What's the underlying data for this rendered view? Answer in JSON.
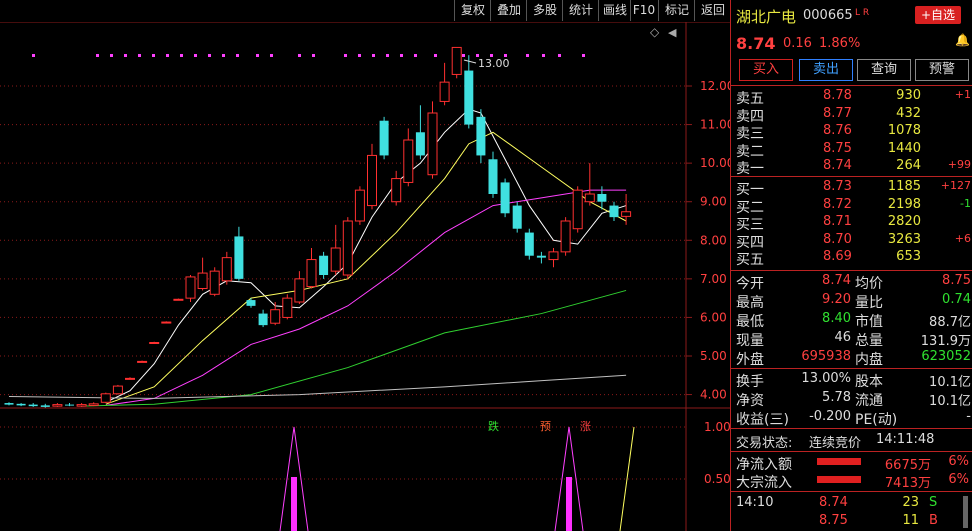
{
  "toolbar": {
    "buttons": [
      "复权",
      "叠加",
      "多股",
      "统计",
      "画线",
      "F10",
      "标记",
      "返回"
    ]
  },
  "chart": {
    "max_label": "13.00",
    "y_ticks": [
      "12.00",
      "11.00",
      "10.00",
      "9.00",
      "8.00",
      "7.00",
      "6.00",
      "5.00",
      "4.00"
    ],
    "sub_ticks": [
      "1.00",
      "0.50"
    ],
    "markers": [
      {
        "text": "跌",
        "color": "#30e030"
      },
      {
        "text": "预",
        "color": "#ff6030"
      },
      {
        "text": "涨",
        "color": "#ff4040"
      }
    ],
    "colors": {
      "up": "#ff3030",
      "down": "#40e0e0",
      "ma5": "#ffffff",
      "ma10": "#ffff60",
      "ma20": "#ff40ff",
      "ma60": "#30d030",
      "ma120": "#c0c0c0",
      "grid": "#8b1a1a"
    }
  },
  "chart_data": {
    "type": "candlestick",
    "ylim": [
      3.6,
      13.4
    ],
    "candles": [
      {
        "o": 3.78,
        "c": 3.74,
        "h": 3.8,
        "l": 3.72
      },
      {
        "o": 3.76,
        "c": 3.72,
        "h": 3.78,
        "l": 3.7
      },
      {
        "o": 3.74,
        "c": 3.7,
        "h": 3.78,
        "l": 3.68
      },
      {
        "o": 3.72,
        "c": 3.68,
        "h": 3.76,
        "l": 3.66
      },
      {
        "o": 3.7,
        "c": 3.74,
        "h": 3.78,
        "l": 3.68
      },
      {
        "o": 3.74,
        "c": 3.72,
        "h": 3.78,
        "l": 3.7
      },
      {
        "o": 3.7,
        "c": 3.74,
        "h": 3.78,
        "l": 3.68
      },
      {
        "o": 3.72,
        "c": 3.76,
        "h": 3.8,
        "l": 3.7
      },
      {
        "o": 3.8,
        "c": 4.02,
        "h": 4.05,
        "l": 3.78
      },
      {
        "o": 4.02,
        "c": 4.22,
        "h": 4.25,
        "l": 4.0
      },
      {
        "o": 4.42,
        "c": 4.42,
        "h": 4.45,
        "l": 4.4
      },
      {
        "o": 4.86,
        "c": 4.86,
        "h": 4.88,
        "l": 4.84
      },
      {
        "o": 5.35,
        "c": 5.35,
        "h": 5.37,
        "l": 5.33
      },
      {
        "o": 5.88,
        "c": 5.88,
        "h": 5.9,
        "l": 5.86
      },
      {
        "o": 6.47,
        "c": 6.47,
        "h": 6.49,
        "l": 6.45
      },
      {
        "o": 6.5,
        "c": 7.05,
        "h": 7.1,
        "l": 6.4
      },
      {
        "o": 6.75,
        "c": 7.15,
        "h": 7.55,
        "l": 6.7
      },
      {
        "o": 6.6,
        "c": 7.2,
        "h": 7.3,
        "l": 6.55
      },
      {
        "o": 6.95,
        "c": 7.55,
        "h": 7.7,
        "l": 6.85
      },
      {
        "o": 8.1,
        "c": 7.0,
        "h": 8.35,
        "l": 6.95
      },
      {
        "o": 6.45,
        "c": 6.3,
        "h": 6.5,
        "l": 6.25
      },
      {
        "o": 6.1,
        "c": 5.8,
        "h": 6.2,
        "l": 5.75
      },
      {
        "o": 5.85,
        "c": 6.2,
        "h": 6.4,
        "l": 5.8
      },
      {
        "o": 6.0,
        "c": 6.5,
        "h": 6.6,
        "l": 5.95
      },
      {
        "o": 6.4,
        "c": 7.0,
        "h": 7.2,
        "l": 6.35
      },
      {
        "o": 6.8,
        "c": 7.5,
        "h": 7.8,
        "l": 6.75
      },
      {
        "o": 7.6,
        "c": 7.1,
        "h": 7.7,
        "l": 7.0
      },
      {
        "o": 7.2,
        "c": 7.8,
        "h": 8.4,
        "l": 7.1
      },
      {
        "o": 7.1,
        "c": 8.5,
        "h": 8.6,
        "l": 7.0
      },
      {
        "o": 8.5,
        "c": 9.3,
        "h": 9.4,
        "l": 8.4
      },
      {
        "o": 8.9,
        "c": 10.2,
        "h": 10.5,
        "l": 8.8
      },
      {
        "o": 11.1,
        "c": 10.2,
        "h": 11.2,
        "l": 10.1
      },
      {
        "o": 9.0,
        "c": 9.6,
        "h": 9.8,
        "l": 8.9
      },
      {
        "o": 9.5,
        "c": 10.6,
        "h": 10.9,
        "l": 9.4
      },
      {
        "o": 10.8,
        "c": 10.2,
        "h": 11.5,
        "l": 10.1
      },
      {
        "o": 9.7,
        "c": 11.3,
        "h": 11.6,
        "l": 9.6
      },
      {
        "o": 11.6,
        "c": 12.1,
        "h": 12.6,
        "l": 11.5
      },
      {
        "o": 12.3,
        "c": 13.0,
        "h": 13.0,
        "l": 12.2
      },
      {
        "o": 12.4,
        "c": 11.0,
        "h": 12.8,
        "l": 10.9
      },
      {
        "o": 11.2,
        "c": 10.2,
        "h": 11.4,
        "l": 10.0
      },
      {
        "o": 10.1,
        "c": 9.2,
        "h": 10.3,
        "l": 9.1
      },
      {
        "o": 9.5,
        "c": 8.7,
        "h": 9.6,
        "l": 8.6
      },
      {
        "o": 8.9,
        "c": 8.3,
        "h": 9.0,
        "l": 8.2
      },
      {
        "o": 8.2,
        "c": 7.6,
        "h": 8.3,
        "l": 7.5
      },
      {
        "o": 7.6,
        "c": 7.55,
        "h": 7.7,
        "l": 7.4
      },
      {
        "o": 7.5,
        "c": 7.7,
        "h": 7.8,
        "l": 7.3
      },
      {
        "o": 7.7,
        "c": 8.5,
        "h": 8.6,
        "l": 7.6
      },
      {
        "o": 8.3,
        "c": 9.3,
        "h": 9.4,
        "l": 8.2
      },
      {
        "o": 9.0,
        "c": 9.2,
        "h": 10.0,
        "l": 8.9
      },
      {
        "o": 9.2,
        "c": 9.0,
        "h": 9.4,
        "l": 8.8
      },
      {
        "o": 8.9,
        "c": 8.6,
        "h": 9.0,
        "l": 8.5
      },
      {
        "o": 8.62,
        "c": 8.74,
        "h": 9.2,
        "l": 8.4
      }
    ],
    "ma": [
      {
        "name": "MA5",
        "color": "#ffffff",
        "points": [
          [
            8,
            3.8
          ],
          [
            10,
            4.1
          ],
          [
            12,
            4.8
          ],
          [
            14,
            5.8
          ],
          [
            16,
            6.6
          ],
          [
            18,
            6.95
          ],
          [
            20,
            6.9
          ],
          [
            22,
            6.3
          ],
          [
            24,
            6.25
          ],
          [
            26,
            6.8
          ],
          [
            28,
            7.4
          ],
          [
            30,
            8.6
          ],
          [
            32,
            9.5
          ],
          [
            34,
            10.0
          ],
          [
            36,
            10.8
          ],
          [
            38,
            11.4
          ],
          [
            39,
            11.3
          ],
          [
            41,
            10.1
          ],
          [
            43,
            8.9
          ],
          [
            45,
            8.0
          ],
          [
            47,
            7.9
          ],
          [
            49,
            8.7
          ],
          [
            51,
            8.9
          ]
        ]
      },
      {
        "name": "MA10",
        "color": "#ffff60",
        "points": [
          [
            8,
            3.75
          ],
          [
            12,
            4.2
          ],
          [
            16,
            5.4
          ],
          [
            20,
            6.5
          ],
          [
            24,
            6.7
          ],
          [
            28,
            7.0
          ],
          [
            32,
            8.2
          ],
          [
            36,
            9.6
          ],
          [
            38,
            10.5
          ],
          [
            40,
            10.8
          ],
          [
            44,
            9.9
          ],
          [
            48,
            9.0
          ],
          [
            51,
            8.5
          ]
        ]
      },
      {
        "name": "MA20",
        "color": "#ff40ff",
        "points": [
          [
            8,
            3.72
          ],
          [
            12,
            3.9
          ],
          [
            16,
            4.5
          ],
          [
            20,
            5.3
          ],
          [
            24,
            5.7
          ],
          [
            28,
            6.3
          ],
          [
            32,
            7.2
          ],
          [
            36,
            8.2
          ],
          [
            40,
            8.9
          ],
          [
            44,
            9.1
          ],
          [
            48,
            9.3
          ],
          [
            51,
            9.3
          ]
        ]
      },
      {
        "name": "MA60",
        "color": "#30d030",
        "points": [
          [
            6,
            3.7
          ],
          [
            12,
            3.75
          ],
          [
            20,
            4.0
          ],
          [
            28,
            4.7
          ],
          [
            36,
            5.6
          ],
          [
            44,
            6.1
          ],
          [
            51,
            6.7
          ]
        ]
      },
      {
        "name": "MA120",
        "color": "#c0c0c0",
        "points": [
          [
            0,
            3.95
          ],
          [
            12,
            3.9
          ],
          [
            24,
            4.0
          ],
          [
            36,
            4.2
          ],
          [
            51,
            4.5
          ]
        ]
      }
    ]
  },
  "panel": {
    "stock_name": "湖北广电",
    "stock_code": "000665",
    "flags": "L R",
    "add_fav": "+自选",
    "price": "8.74",
    "change": "0.16",
    "change_pct": "1.86%",
    "buttons": [
      "买入",
      "卖出",
      "查询",
      "预警"
    ],
    "asks": [
      {
        "label": "卖五",
        "price": "8.78",
        "vol": "930",
        "delta": "+1"
      },
      {
        "label": "卖四",
        "price": "8.77",
        "vol": "432",
        "delta": ""
      },
      {
        "label": "卖三",
        "price": "8.76",
        "vol": "1078",
        "delta": ""
      },
      {
        "label": "卖二",
        "price": "8.75",
        "vol": "1440",
        "delta": ""
      },
      {
        "label": "卖一",
        "price": "8.74",
        "vol": "264",
        "delta": "+99"
      }
    ],
    "bids": [
      {
        "label": "买一",
        "price": "8.73",
        "vol": "1185",
        "delta": "+127",
        "dc": "#ff4040"
      },
      {
        "label": "买二",
        "price": "8.72",
        "vol": "2198",
        "delta": "-1",
        "dc": "#30e030"
      },
      {
        "label": "买三",
        "price": "8.71",
        "vol": "2820",
        "delta": "",
        "dc": "#ff4040"
      },
      {
        "label": "买四",
        "price": "8.70",
        "vol": "3263",
        "delta": "+6",
        "dc": "#ff4040"
      },
      {
        "label": "买五",
        "price": "8.69",
        "vol": "653",
        "delta": "",
        "dc": "#ff4040"
      }
    ],
    "stats": [
      {
        "l1": "今开",
        "v1": "8.74",
        "c1": "#ff4040",
        "l2": "均价",
        "v2": "8.75",
        "c2": "#ff4040"
      },
      {
        "l1": "最高",
        "v1": "9.20",
        "c1": "#ff4040",
        "l2": "量比",
        "v2": "0.74",
        "c2": "#30e030"
      },
      {
        "l1": "最低",
        "v1": "8.40",
        "c1": "#30e030",
        "l2": "市值",
        "v2": "88.7亿",
        "c2": "#ddd"
      },
      {
        "l1": "现量",
        "v1": "46",
        "c1": "#ddd",
        "l2": "总量",
        "v2": "131.9万",
        "c2": "#ddd"
      },
      {
        "l1": "外盘",
        "v1": "695938",
        "c1": "#ff4040",
        "l2": "内盘",
        "v2": "623052",
        "c2": "#30e030"
      }
    ],
    "stats2": [
      {
        "l1": "换手",
        "v1": "13.00%",
        "l2": "股本",
        "v2": "10.1亿"
      },
      {
        "l1": "净资",
        "v1": "5.78",
        "l2": "流通",
        "v2": "10.1亿"
      },
      {
        "l1": "收益(三)",
        "v1": "-0.200",
        "l2": "PE(动)",
        "v2": "-"
      }
    ],
    "status_label": "交易状态:",
    "status_value": "连续竞价",
    "status_time": "14:11:48",
    "flows": [
      {
        "label": "净流入额",
        "value": "6675万",
        "pct": "6%"
      },
      {
        "label": "大宗流入",
        "value": "7413万",
        "pct": "6%"
      }
    ],
    "ticks": [
      {
        "time": "14:10",
        "price": "8.74",
        "vol": "23",
        "side": "S",
        "side_color": "#30e030"
      },
      {
        "time": "",
        "price": "8.75",
        "vol": "11",
        "side": "B",
        "side_color": "#ff4040"
      }
    ]
  }
}
